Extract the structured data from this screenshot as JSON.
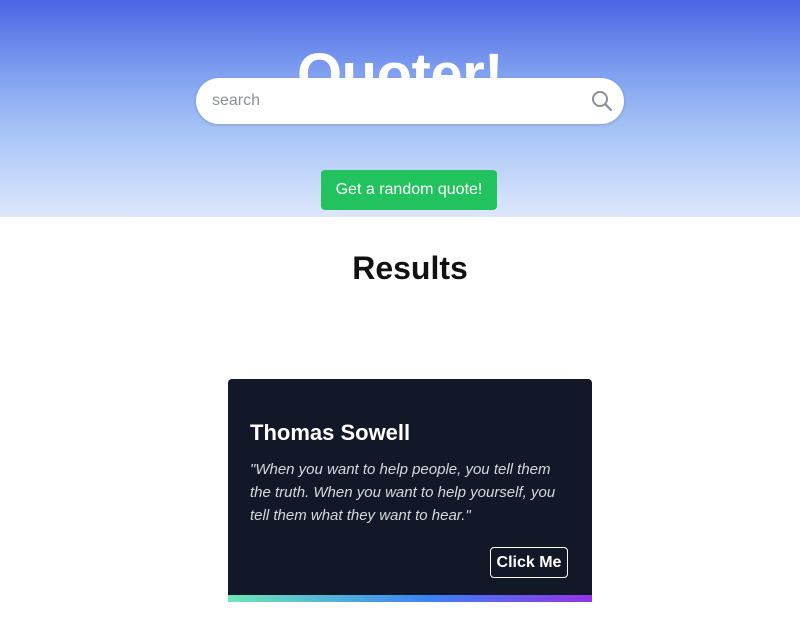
{
  "app": {
    "title": "Quoter!"
  },
  "search": {
    "placeholder": "search",
    "value": "",
    "icon": "search-icon"
  },
  "random_button": {
    "label": "Get a random quote!"
  },
  "results": {
    "heading": "Results",
    "quotes": [
      {
        "author": "Thomas Sowell",
        "text": "\"When you want to help people, you tell them the truth. When you want to help yourself, you tell them what they want to hear.\"",
        "button_label": "Click Me"
      }
    ]
  },
  "colors": {
    "hero_gradient_top": "#4a64e3",
    "hero_gradient_bottom": "#dde7fb",
    "random_button": "#22c25f",
    "card_background": "#121828",
    "card_accent_start": "#6ee7b7",
    "card_accent_mid": "#3b82f6",
    "card_accent_end": "#9333ea"
  }
}
